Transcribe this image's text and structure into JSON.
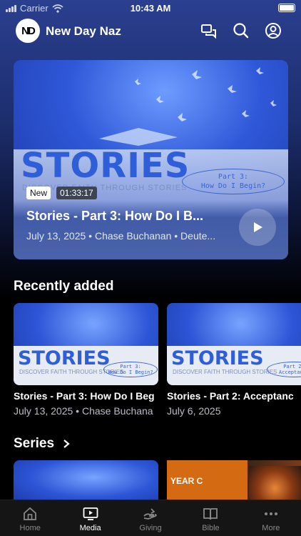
{
  "status_bar": {
    "carrier": "Carrier",
    "time": "10:43 AM"
  },
  "header": {
    "app_title": "New Day Naz",
    "logo_text": "ND"
  },
  "featured": {
    "art_word": "STORIES",
    "art_subtitle": "DISCOVER FAITH THROUGH STORIES",
    "art_part": "Part 3:",
    "art_part_title": "How Do I Begin?",
    "badge_new": "New",
    "duration": "01:33:17",
    "title": "Stories - Part 3: How Do I B...",
    "meta": "July 13, 2025 • Chase Buchanan • Deute..."
  },
  "recently_added": {
    "heading": "Recently added",
    "items": [
      {
        "art_word": "STORIES",
        "art_subtitle": "DISCOVER FAITH THROUGH STORIES",
        "art_part": "Part 3:",
        "art_part_title": "How Do I Begin?",
        "title": "Stories - Part 3: How Do I Beg",
        "meta": "July 13, 2025 • Chase Buchana"
      },
      {
        "art_word": "STORIES",
        "art_subtitle": "DISCOVER FAITH THROUGH STORIES",
        "art_part": "Part 2:",
        "art_part_title": "Acceptance",
        "title": "Stories - Part 2: Acceptanc",
        "meta": "July 6, 2025"
      }
    ]
  },
  "series": {
    "heading": "Series",
    "second_label": "YEAR C"
  },
  "tabs": [
    {
      "label": "Home",
      "icon": "home-icon"
    },
    {
      "label": "Media",
      "icon": "media-icon"
    },
    {
      "label": "Giving",
      "icon": "giving-icon"
    },
    {
      "label": "Bible",
      "icon": "bible-icon"
    },
    {
      "label": "More",
      "icon": "more-icon"
    }
  ],
  "colors": {
    "accent_blue": "#2f5fd8",
    "hero_card": "#4a63aa",
    "tab_active": "#ffffff",
    "tab_inactive": "#8a8a8a",
    "series_orange": "#d46b12"
  }
}
